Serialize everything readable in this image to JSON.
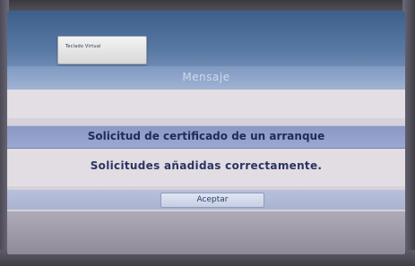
{
  "keyboard_tab": {
    "label": "Teclado Virtual"
  },
  "dialog": {
    "title": "Mensaje",
    "subtitle": "Solicitud de certificado de un arranque",
    "message": "Solicitudes añadidas correctamente.",
    "accept_label": "Aceptar"
  },
  "colors": {
    "title_bar": "#8fa6c9",
    "subtitle_band": "#94a2cd",
    "text": "#2a3560"
  }
}
